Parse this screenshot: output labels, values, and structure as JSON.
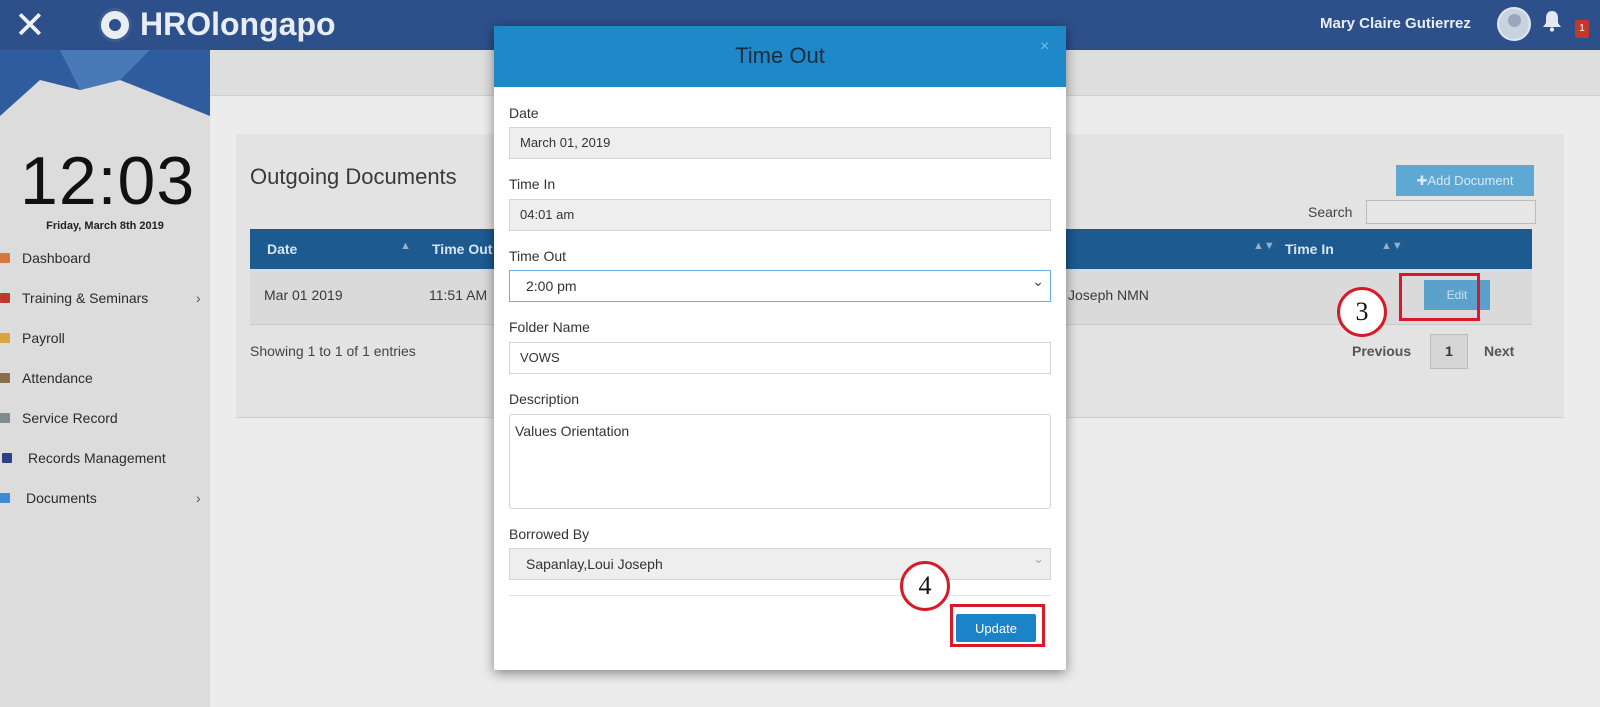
{
  "app": {
    "brand": "HROlongapo",
    "user_name": "Mary Claire Gutierrez",
    "notification_count": "1"
  },
  "sidebar": {
    "clock": "12:03",
    "date": "Friday, March 8th 2019",
    "items": [
      {
        "label": "Dashboard",
        "icon": "dashboard-icon",
        "color": "#d9763a"
      },
      {
        "label": "Training & Seminars",
        "icon": "training-icon",
        "color": "#c0392b",
        "has_submenu": true
      },
      {
        "label": "Payroll",
        "icon": "payroll-icon",
        "color": "#d9a53a"
      },
      {
        "label": "Attendance",
        "icon": "attendance-icon",
        "color": "#8a6d4a"
      },
      {
        "label": "Service Record",
        "icon": "service-record-icon",
        "color": "#7f8c8d"
      },
      {
        "label": "Records Management",
        "icon": "records-icon",
        "color": "#2d3f8a"
      },
      {
        "label": "Documents",
        "icon": "documents-icon",
        "color": "#3a8ad9",
        "has_submenu": true
      }
    ]
  },
  "page": {
    "title": "Outgoing Documents",
    "add_button": "✚Add Document",
    "search_label": "Search",
    "columns": [
      "Date",
      "Time Out",
      "Time In"
    ],
    "row": {
      "date": "Mar 01 2019",
      "time_out": "11:51 AM",
      "borrowed_by_fragment": "Joseph NMN",
      "action": "Edit"
    },
    "showing": "Showing 1 to 1 of 1 entries",
    "pager": {
      "previous": "Previous",
      "page": "1",
      "next": "Next"
    }
  },
  "modal": {
    "title": "Time Out",
    "close": "×",
    "date_label": "Date",
    "date_value": "March 01, 2019",
    "time_in_label": "Time In",
    "time_in_value": "04:01 am",
    "time_out_label": "Time Out",
    "time_out_value": "2:00 pm",
    "folder_label": "Folder Name",
    "folder_value": "VOWS",
    "description_label": "Description",
    "description_value": "Values Orientation",
    "borrowed_label": "Borrowed By",
    "borrowed_value": "Sapanlay,Loui Joseph",
    "update_button": "Update"
  },
  "annotations": {
    "step3": "3",
    "step4": "4"
  }
}
